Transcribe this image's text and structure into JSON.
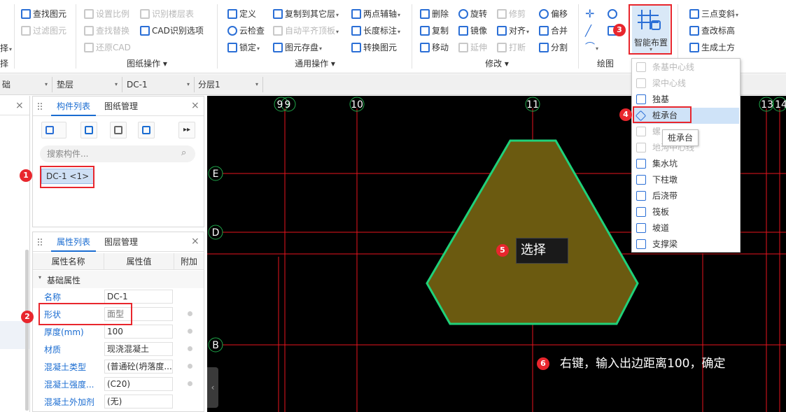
{
  "ribbon": {
    "col0": {
      "top_label": "择",
      "bottom_label": "择"
    },
    "col1": {
      "find_item": "查找图元",
      "filter_item": "过滤图元"
    },
    "cad_ops": {
      "set_scale": "设置比例",
      "recognize_floor_table": "识别楼层表",
      "find_replace": "查找替换",
      "cad_recognize_options": "CAD识别选项",
      "restore_cad": "还原CAD",
      "group_label": "图纸操作"
    },
    "general_ops": {
      "define": "定义",
      "copy_to_layer": "复制到其它层",
      "two_point_axis": "两点辅轴",
      "cloud_check": "云检查",
      "auto_flat_slab": "自动平齐顶板",
      "length_dim": "长度标注",
      "lock": "锁定",
      "element_storage": "图元存盘",
      "convert_element": "转换图元",
      "group_label": "通用操作"
    },
    "modify": {
      "delete": "删除",
      "rotate": "旋转",
      "trim": "修剪",
      "offset": "偏移",
      "copy": "复制",
      "mirror": "镜像",
      "align": "对齐",
      "merge": "合并",
      "move": "移动",
      "extend": "延伸",
      "break": "打断",
      "split": "分割",
      "group_label": "修改"
    },
    "draw": {
      "group_label": "绘图"
    },
    "smart_layout": {
      "label": "智能布置"
    },
    "right_col": {
      "three_point_slope": "三点变斜",
      "check_elevation": "查改标高",
      "gen_earthwork": "生成土方"
    }
  },
  "toolbar": {
    "dd0": "础",
    "dd1": "垫层",
    "dd2": "DC-1",
    "dd3": "分层1"
  },
  "component_panel": {
    "tab_active": "构件列表",
    "tab_other": "图纸管理",
    "search_placeholder": "搜索构件...",
    "selected_item": "DC-1 <1>"
  },
  "property_panel": {
    "tab_active": "属性列表",
    "tab_other": "图层管理",
    "col_name": "属性名称",
    "col_value": "属性值",
    "col_extra": "附加",
    "section": "基础属性",
    "rows": [
      {
        "name": "名称",
        "value": "DC-1"
      },
      {
        "name": "形状",
        "value": "面型"
      },
      {
        "name": "厚度(mm)",
        "value": "100"
      },
      {
        "name": "材质",
        "value": "现浇混凝土"
      },
      {
        "name": "混凝土类型",
        "value": "(普通砼(坍落度..."
      },
      {
        "name": "混凝土强度...",
        "value": "(C20)"
      },
      {
        "name": "混凝土外加剂",
        "value": "(无)"
      }
    ]
  },
  "canvas": {
    "axes_top": [
      "9",
      "9",
      "10",
      "11",
      "13",
      "14"
    ],
    "axes_left": [
      "E",
      "D",
      "B"
    ],
    "colors": {
      "bg": "#000000",
      "axis": "#e8141e",
      "shape_fill": "#6b5a10",
      "shape_stroke": "#1fd17a"
    }
  },
  "dropdown": {
    "items": [
      {
        "label": "条基中心线",
        "disabled": true
      },
      {
        "label": "梁中心线",
        "disabled": true
      },
      {
        "label": "独基",
        "disabled": false
      },
      {
        "label": "桩承台",
        "disabled": false,
        "highlighted": true
      },
      {
        "label": "螺",
        "disabled": true
      },
      {
        "label": "地沟中心线",
        "disabled": true
      },
      {
        "label": "集水坑",
        "disabled": false
      },
      {
        "label": "下柱墩",
        "disabled": false
      },
      {
        "label": "后浇带",
        "disabled": false
      },
      {
        "label": "筏板",
        "disabled": false
      },
      {
        "label": "坡道",
        "disabled": false
      },
      {
        "label": "支撑梁",
        "disabled": false
      }
    ],
    "tooltip": "桩承台"
  },
  "annotations": {
    "b1": "1",
    "b2": "2",
    "b3": "3",
    "b4": "4",
    "b5": "5",
    "b6": "6",
    "select_label": "选择",
    "instruction": "右键，输入出边距离100，确定"
  }
}
